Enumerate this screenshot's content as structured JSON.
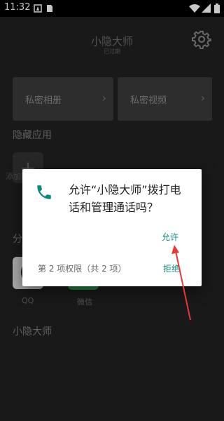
{
  "status_bar": {
    "time": "11:32"
  },
  "header": {
    "title": "小隐大师",
    "subtitle": "已过期"
  },
  "tiles": [
    {
      "label": "私密相册",
      "chevron": "›"
    },
    {
      "label": "私密视频",
      "chevron": "›"
    }
  ],
  "hidden_apps": {
    "title": "隐藏应用",
    "add_label": "添加隐"
  },
  "shared_section": {
    "title": "分"
  },
  "apps": [
    {
      "name": "QQ"
    },
    {
      "name": "微信"
    }
  ],
  "footer_title": "小隐大师",
  "dialog": {
    "line1": "允许“小隐大师”拨打电",
    "line2": "话和管理通话吗？",
    "allow_label": "允许",
    "permission_count": "第 2 项权限（共 2 项）",
    "deny_label": "拒绝"
  },
  "colors": {
    "accent": "#0b8a7a",
    "annotation_arrow": "#e53935"
  },
  "icons": [
    "phone-icon",
    "gear-icon",
    "wifi-icon",
    "signal-icon",
    "battery-icon"
  ]
}
